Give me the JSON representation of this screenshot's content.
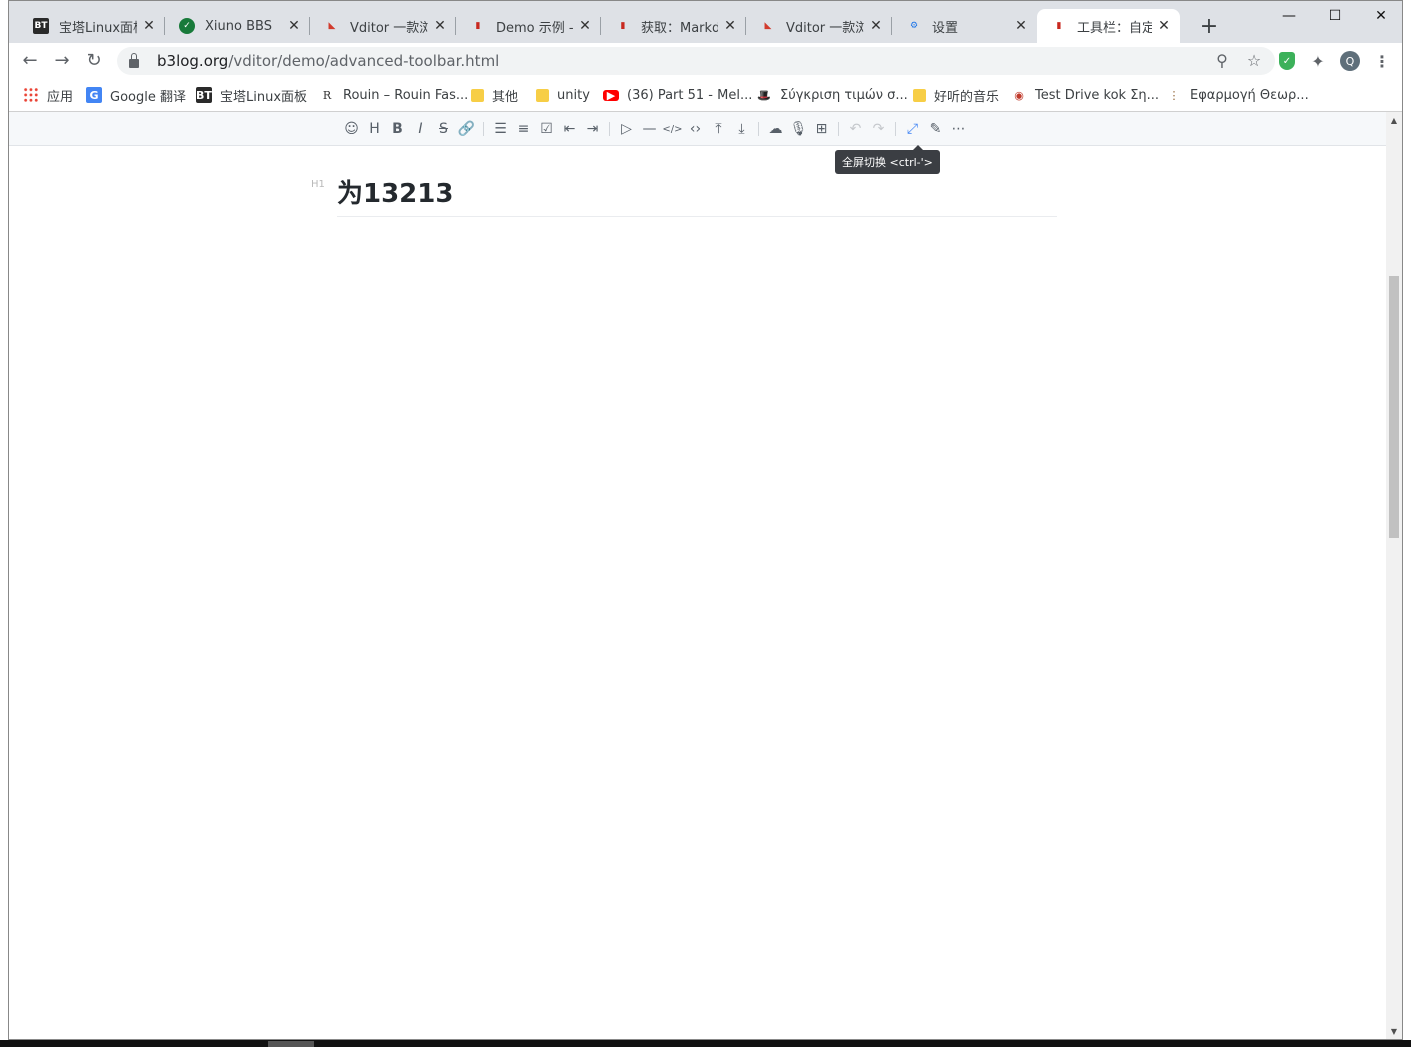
{
  "tabs": [
    {
      "icon": "bt-icon",
      "fav": "BT",
      "title": "宝塔Linux面板"
    },
    {
      "icon": "xiuno-shield-icon",
      "fav": "✓",
      "title": "Xiuno BBS"
    },
    {
      "icon": "vditor-icon",
      "fav": "◣",
      "title": "Vditor 一款浏览"
    },
    {
      "icon": "book-icon",
      "fav": "▮",
      "title": "Demo 示例 - V"
    },
    {
      "icon": "book-icon",
      "fav": "▮",
      "title": "获取：Markdo"
    },
    {
      "icon": "vditor-icon",
      "fav": "◣",
      "title": "Vditor 一款浏览"
    },
    {
      "icon": "gear-icon",
      "fav": "⚙",
      "title": "设置"
    },
    {
      "icon": "book-icon",
      "fav": "▮",
      "title": "工具栏：自定义"
    }
  ],
  "window": {
    "minimize": "—",
    "maximize": "☐",
    "close": "✕",
    "new_tab": "+"
  },
  "address": {
    "host": "b3log.org",
    "path": "/vditor/demo/advanced-toolbar.html"
  },
  "bookmarks": [
    {
      "label": "应用",
      "icon": "apps-icon"
    },
    {
      "label": "Google 翻译",
      "icon": "google-translate-icon"
    },
    {
      "label": "宝塔Linux面板",
      "icon": "bt-icon"
    },
    {
      "label": "Rouin – Rouin Fas...",
      "icon": "rouin-icon"
    },
    {
      "label": "其他",
      "icon": "folder-icon"
    },
    {
      "label": "unity",
      "icon": "folder-icon"
    },
    {
      "label": "(36) Part 51 - Mel...",
      "icon": "youtube-icon"
    },
    {
      "label": "Σύγκριση τιμών σ...",
      "icon": "hat-icon"
    },
    {
      "label": "好听的音乐",
      "icon": "folder-icon"
    },
    {
      "label": "Test Drive kok Ση...",
      "icon": "car-icon"
    },
    {
      "label": "Εφαρμογή Θεωρ...",
      "icon": "traffic-light-icon"
    }
  ],
  "editor": {
    "heading_marker": "H1",
    "heading": "为13213",
    "tooltip": "全屏切换 <ctrl-'>"
  },
  "toolbar_groups": [
    [
      {
        "name": "emoji-icon",
        "glyph": "☺"
      },
      {
        "name": "headings-icon",
        "glyph": "H"
      },
      {
        "name": "bold-icon",
        "glyph": "B"
      },
      {
        "name": "italic-icon",
        "glyph": "I"
      },
      {
        "name": "strike-icon",
        "glyph": "S"
      },
      {
        "name": "link-icon",
        "glyph": "🔗"
      }
    ],
    [
      {
        "name": "list-icon",
        "glyph": "☰"
      },
      {
        "name": "ordered-list-icon",
        "glyph": "≡"
      },
      {
        "name": "check-icon",
        "glyph": "☑"
      },
      {
        "name": "outdent-icon",
        "glyph": "⇤"
      },
      {
        "name": "indent-icon",
        "glyph": "⇥"
      }
    ],
    [
      {
        "name": "quote-icon",
        "glyph": "▷"
      },
      {
        "name": "line-icon",
        "glyph": "—"
      },
      {
        "name": "code-icon",
        "glyph": "</>"
      },
      {
        "name": "inline-code-icon",
        "glyph": "‹›"
      },
      {
        "name": "insert-before-icon",
        "glyph": "⤒"
      },
      {
        "name": "insert-after-icon",
        "glyph": "⤓"
      }
    ],
    [
      {
        "name": "upload-icon",
        "glyph": "☁"
      },
      {
        "name": "record-icon",
        "glyph": "🎙"
      },
      {
        "name": "table-icon",
        "glyph": "⊞"
      }
    ],
    [
      {
        "name": "undo-icon",
        "glyph": "↶",
        "disabled": true
      },
      {
        "name": "redo-icon",
        "glyph": "↷",
        "disabled": true
      }
    ],
    [
      {
        "name": "fullscreen-icon",
        "glyph": "⤢",
        "active": true
      },
      {
        "name": "edit-mode-icon",
        "glyph": "✎"
      },
      {
        "name": "more-icon",
        "glyph": "⋯"
      }
    ]
  ],
  "colors": {
    "accent": "#4285f4",
    "tab_strip": "#dee1e6",
    "toolbar_bg": "#f6f8fa"
  }
}
